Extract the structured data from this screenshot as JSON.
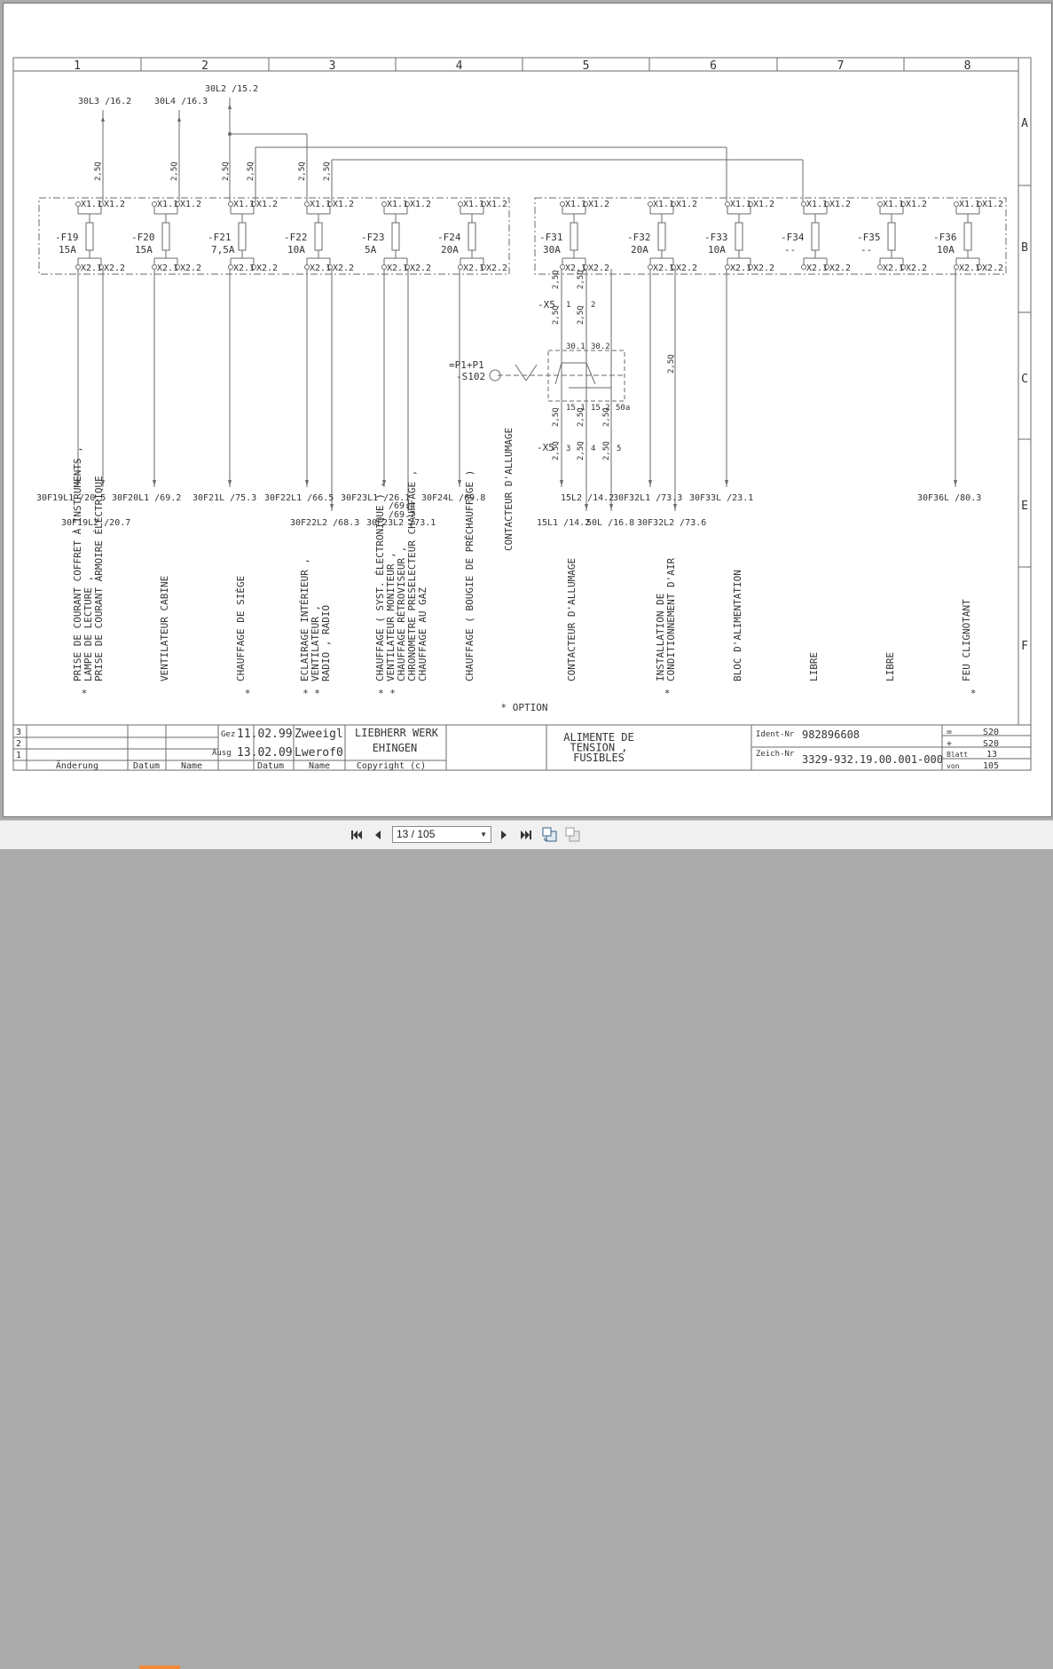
{
  "columns": [
    "1",
    "2",
    "3",
    "4",
    "5",
    "6",
    "7",
    "8"
  ],
  "rows": [
    "A",
    "B",
    "C",
    "E",
    "F"
  ],
  "supplies": [
    {
      "label": "30L3 /16.2"
    },
    {
      "label": "30L4 /16.3"
    },
    {
      "label": "30L2 /15.2"
    }
  ],
  "wire_size": "2,5Q",
  "terminals": {
    "top_left": "X1.1",
    "top_right": "X1.2",
    "bottom_left": "X2.1",
    "bottom_right": "X2.2"
  },
  "fuses": [
    {
      "name": "-F19",
      "rating": "15A"
    },
    {
      "name": "-F20",
      "rating": "15A"
    },
    {
      "name": "-F21",
      "rating": "7,5A"
    },
    {
      "name": "-F22",
      "rating": "10A"
    },
    {
      "name": "-F23",
      "rating": "5A"
    },
    {
      "name": "-F24",
      "rating": "20A"
    },
    {
      "name": "-F31",
      "rating": "30A"
    },
    {
      "name": "-F32",
      "rating": "20A"
    },
    {
      "name": "-F33",
      "rating": "10A"
    },
    {
      "name": "-F34",
      "rating": "--"
    },
    {
      "name": "-F35",
      "rating": "--"
    },
    {
      "name": "-F36",
      "rating": "10A"
    }
  ],
  "switch": {
    "tag1": "=P1+P1",
    "tag2": "-S102",
    "x5": "-X5",
    "pins_top": [
      "1",
      "2"
    ],
    "pins_bottom": [
      "3",
      "4",
      "5"
    ],
    "contacts_top": [
      "30.1",
      "30.2"
    ],
    "contacts_bottom": [
      "15.1",
      "15.2",
      "50a"
    ]
  },
  "xrefs_row1": [
    "30F19L1 /20.5",
    "30F20L1 /69.2",
    "30F21L /75.3",
    "30F22L1 /66.5",
    "30F23L1 /26.1",
    "30F24L /69.8",
    "15L2 /14.2",
    "30F32L1 /73.3",
    "30F33L /23.1",
    "30F36L /80.3"
  ],
  "xrefs_row2": [
    "30F19L2 /20.7",
    "30F22L2 /68.3",
    "30F23L2 /73.1",
    "15L1 /14.2",
    "50L /16.8",
    "30F32L2 /73.6"
  ],
  "xrefs_extra": [
    "/69.4",
    "/69.7"
  ],
  "descriptions": [
    {
      "lines": [
        "PRISE DE COURANT COFFRET À INSTRUMENTS ,",
        "LAMPE DE LECTURE ,",
        "PRISE DE COURANT ARMOIRE ÉLECTRIQUE"
      ],
      "mark": "*"
    },
    {
      "lines": [
        "VENTILATEUR CABINE"
      ],
      "mark": ""
    },
    {
      "lines": [
        "CHAUFFAGE DE SIÈGE"
      ],
      "mark": "*"
    },
    {
      "lines": [
        "ECLAIRAGE INTÉRIEUR ,",
        "VENTILATEUR ,",
        "RADIO , RADIO"
      ],
      "mark": "* *"
    },
    {
      "lines": [
        "CHAUFFAGE ( SYST. ÉLECTRONIQUE ) ,",
        "VENTILATEUR MONITEUR ,",
        "CHAUFFAGE RÉTROVISEUR ,",
        "CHRONOMETRE PRESELECTEUR CHAUFFAGE ,",
        "CHAUFFAGE AU GAZ"
      ],
      "mark": "* *"
    },
    {
      "lines": [
        "CHAUFFAGE ( BOUGIE DE PRÉCHAUFFAGE )"
      ],
      "mark": ""
    },
    {
      "lines": [
        "CONTACTEUR D'ALLUMAGE"
      ],
      "mark": ""
    },
    {
      "lines": [
        "CONTACTEUR D'ALLUMAGE"
      ],
      "mark": ""
    },
    {
      "lines": [
        "INSTALLATION DE",
        "CONDITIONNEMENT D'AIR"
      ],
      "mark": "*"
    },
    {
      "lines": [
        "BLOC D'ALIMENTATION"
      ],
      "mark": ""
    },
    {
      "lines": [
        "LIBRE"
      ],
      "mark": ""
    },
    {
      "lines": [
        "LIBRE"
      ],
      "mark": ""
    },
    {
      "lines": [
        "FEU CLIGNOTANT"
      ],
      "mark": "*"
    }
  ],
  "option_note": "* OPTION",
  "title_block": {
    "rev_rows": [
      "3",
      "2",
      "1"
    ],
    "headers": [
      "Änderung",
      "Datum",
      "Name",
      "Datum",
      "Name",
      "Copyright (c)"
    ],
    "gez_label": "Gez",
    "gez_date": "11.02.99",
    "gez_name": "Zweeigl",
    "ausg_label": "Ausg",
    "ausg_date": "13.02.09",
    "ausg_name": "Lwerof0",
    "company": "LIEBHERR WERK",
    "city": "EHINGEN",
    "title_lines": [
      "ALIMENTE DE",
      "TENSION ,",
      "FUSIBLES"
    ],
    "ident_label": "Ident-Nr",
    "ident_value": "982896608",
    "zeich_label": "Zeich-Nr",
    "zeich_value": "3329-932.19.00.001-000",
    "eq_sign": "=",
    "eq_value": "S20",
    "plus_sign": "+",
    "plus_value": "S20",
    "blatt_label": "Blatt",
    "blatt_value": "13",
    "von_label": "von",
    "von_value": "105"
  },
  "viewer": {
    "page_display": "13 / 105",
    "accent_color": "#f08a3c"
  }
}
